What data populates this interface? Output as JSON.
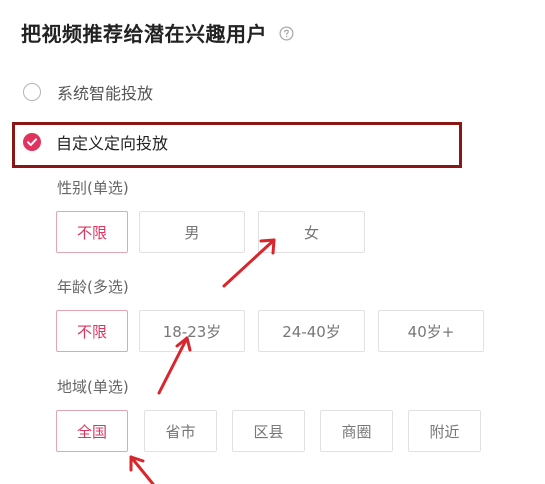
{
  "header": {
    "title": "把视频推荐给潜在兴趣用户",
    "help_icon": "question-circle-icon"
  },
  "targeting": {
    "smart_label": "系统智能投放",
    "custom_label": "自定义定向投放",
    "selected": "custom"
  },
  "gender": {
    "label": "性别(单选)",
    "options": [
      "不限",
      "男",
      "女"
    ],
    "selected": "不限"
  },
  "age": {
    "label": "年龄(多选)",
    "options": [
      "不限",
      "18-23岁",
      "24-40岁",
      "40岁+"
    ],
    "selected": "不限"
  },
  "region": {
    "label": "地域(单选)",
    "options": [
      "全国",
      "省市",
      "区县",
      "商圈",
      "附近"
    ],
    "selected": "全国"
  },
  "colors": {
    "accent": "#e0345f",
    "selected_border": "#e2a5b4",
    "annotation_red": "#d9262c",
    "highlight_box": "#8b1616"
  }
}
